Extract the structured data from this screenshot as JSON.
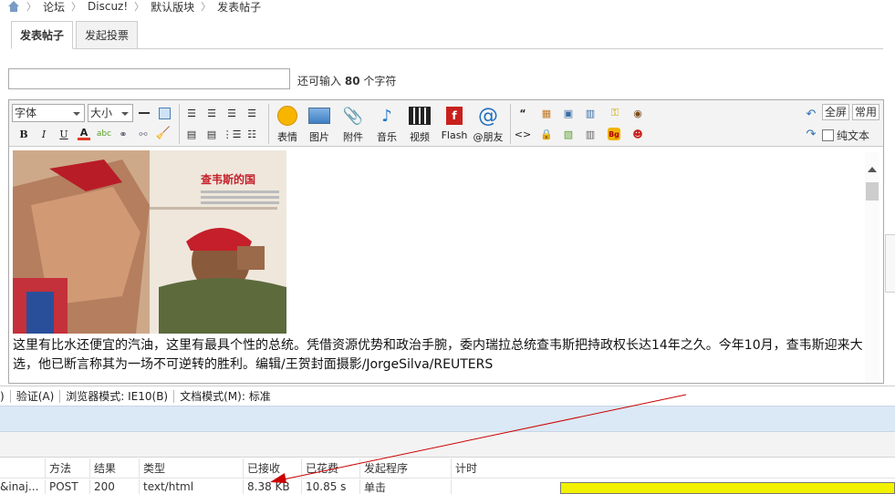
{
  "breadcrumb": {
    "items": [
      "论坛",
      "Discuz!",
      "默认版块",
      "发表帖子"
    ]
  },
  "tabs": [
    {
      "label": "发表帖子",
      "active": true
    },
    {
      "label": "发起投票",
      "active": false
    }
  ],
  "subject": {
    "value": "",
    "remaining_prefix": "还可输入",
    "remaining_count": "80",
    "remaining_suffix": "个字符"
  },
  "toolbar": {
    "font_select": "字体",
    "size_select": "大小",
    "emoticon": "表情",
    "image": "图片",
    "attachment": "附件",
    "music": "音乐",
    "video": "视频",
    "flash": "Flash",
    "mention": "@朋友",
    "fullscreen": "全屏",
    "common": "常用",
    "plaintext": "纯文本"
  },
  "photo": {
    "headline": "查韦斯的国"
  },
  "caption": "这里有比水还便宜的汽油，这里有最具个性的总统。凭借资源优势和政治手腕，委内瑞拉总统查韦斯把持政权长达14年之久。今年10月，查韦斯迎来大选，他已断言称其为一场不可逆转的胜利。编辑/王贺封面摄影/JorgeSilva/REUTERS",
  "devtools": {
    "menu": [
      ")",
      "验证(A)",
      "浏览器模式: IE10(B)",
      "文档模式(M): 标准"
    ],
    "columns": [
      "",
      "方法",
      "结果",
      "类型",
      "已接收",
      "已花费",
      "发起程序",
      "计时"
    ],
    "row": [
      "&inaj...",
      "POST",
      "200",
      "text/html",
      "8.38 KB",
      "10.85 s",
      "单击",
      ""
    ]
  },
  "colors": {
    "timing_bar": "#f2f200",
    "annotation_arrow": "#cc0000"
  }
}
